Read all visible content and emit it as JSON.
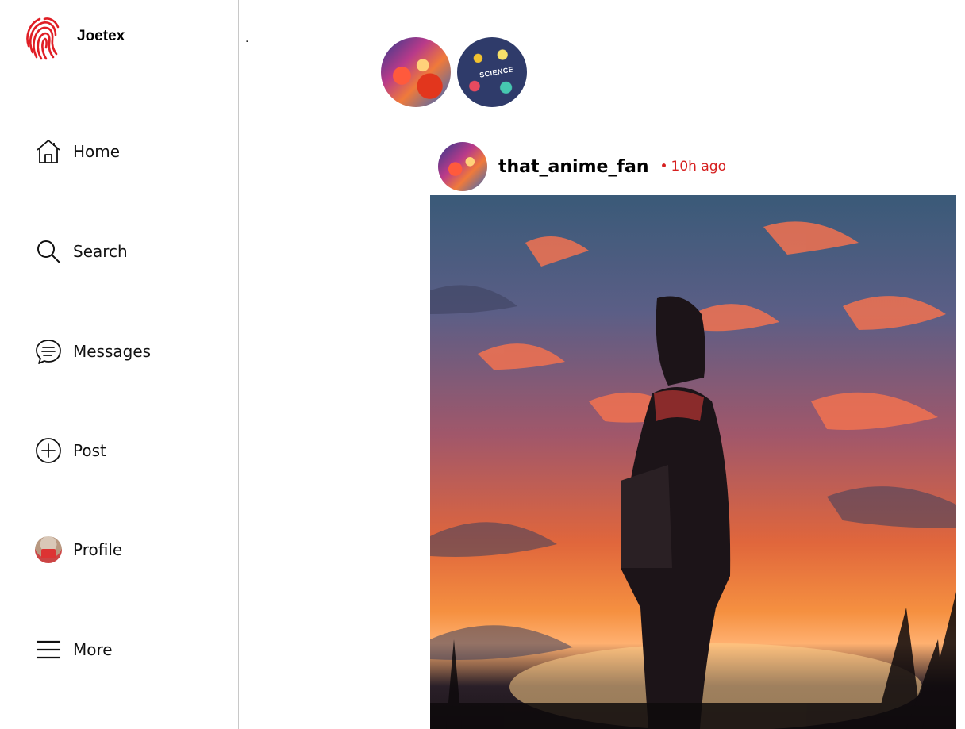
{
  "brand": {
    "name": "Joetex",
    "logo_icon": "fingerprint-logo-icon",
    "accent": "#e01e25"
  },
  "nav": {
    "items": [
      {
        "label": "Home",
        "icon": "home-icon"
      },
      {
        "label": "Search",
        "icon": "search-icon"
      },
      {
        "label": "Messages",
        "icon": "message-icon"
      },
      {
        "label": "Post",
        "icon": "plus-circle-icon"
      },
      {
        "label": "Profile",
        "icon": "profile-avatar"
      },
      {
        "label": "More",
        "icon": "hamburger-menu-icon"
      }
    ]
  },
  "main": {
    "marker": ".",
    "stories": [
      {
        "icon": "anime-story-avatar"
      },
      {
        "icon": "science-story-avatar",
        "text": "SCIENCE"
      }
    ]
  },
  "post": {
    "username": "that_anime_fan",
    "time": "10h ago",
    "time_color": "#d62020",
    "image": "anime-sunset-girl-image"
  }
}
